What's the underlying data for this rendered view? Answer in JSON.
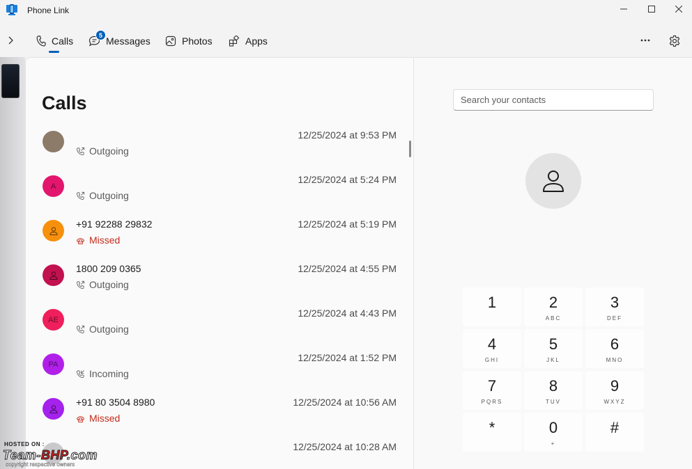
{
  "window": {
    "title": "Phone Link",
    "controls": [
      "minimize",
      "maximize",
      "close"
    ]
  },
  "nav": {
    "tabs": [
      {
        "label": "Calls",
        "icon": "phone-icon",
        "active": true
      },
      {
        "label": "Messages",
        "icon": "chat-icon",
        "badge": "5"
      },
      {
        "label": "Photos",
        "icon": "photo-icon"
      },
      {
        "label": "Apps",
        "icon": "apps-icon"
      }
    ]
  },
  "calls": {
    "title": "Calls",
    "items": [
      {
        "name": "",
        "initials": "",
        "type": "Outgoing",
        "time": "12/25/2024 at 9:53 PM",
        "avatar_color": "#8d7b6a"
      },
      {
        "name": "",
        "initials": "A",
        "type": "Outgoing",
        "time": "12/25/2024 at 5:24 PM",
        "avatar_color": "#e3166e"
      },
      {
        "name": "+91 92288 29832",
        "initials": "",
        "type": "Missed",
        "time": "12/25/2024 at 5:19 PM",
        "avatar_color": "#f7900c"
      },
      {
        "name": "1800 209 0365",
        "initials": "",
        "type": "Outgoing",
        "time": "12/25/2024 at 4:55 PM",
        "avatar_color": "#c2114f"
      },
      {
        "name": "",
        "initials": "AE",
        "type": "Outgoing",
        "time": "12/25/2024 at 4:43 PM",
        "avatar_color": "#ef1e5c"
      },
      {
        "name": "",
        "initials": "PA",
        "type": "Incoming",
        "time": "12/25/2024 at 1:52 PM",
        "avatar_color": "#b020e8"
      },
      {
        "name": "+91 80 3504 8980",
        "initials": "",
        "type": "Missed",
        "time": "12/25/2024 at 10:56 AM",
        "avatar_color": "#a422ec"
      },
      {
        "name": "",
        "initials": "",
        "type": "",
        "time": "12/25/2024 at 10:28 AM",
        "avatar_color": "#c9c9cc"
      }
    ]
  },
  "dialer": {
    "search_placeholder": "Search your contacts",
    "keys": [
      {
        "digit": "1",
        "letters": ""
      },
      {
        "digit": "2",
        "letters": "ABC"
      },
      {
        "digit": "3",
        "letters": "DEF"
      },
      {
        "digit": "4",
        "letters": "GHI"
      },
      {
        "digit": "5",
        "letters": "JKL"
      },
      {
        "digit": "6",
        "letters": "MNO"
      },
      {
        "digit": "7",
        "letters": "PQRS"
      },
      {
        "digit": "8",
        "letters": "TUV"
      },
      {
        "digit": "9",
        "letters": "WXYZ"
      },
      {
        "digit": "*",
        "letters": ""
      },
      {
        "digit": "0",
        "letters": "+"
      },
      {
        "digit": "#",
        "letters": ""
      }
    ]
  },
  "watermark": {
    "hosted": "HOSTED ON :",
    "logo_main": "Team-",
    "logo_accent": "BHP",
    "logo_suffix": ".com",
    "copyright": "copyright respective owners"
  },
  "colors": {
    "accent": "#005fb8",
    "missed": "#c42b1c"
  }
}
